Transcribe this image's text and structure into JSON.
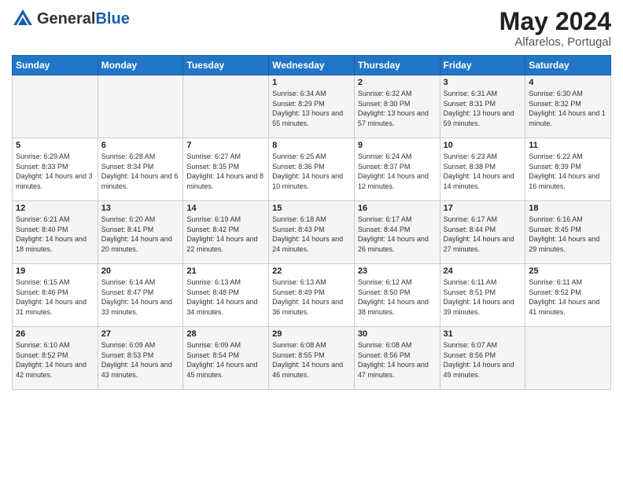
{
  "header": {
    "logo_general": "General",
    "logo_blue": "Blue",
    "month": "May 2024",
    "location": "Alfarelos, Portugal"
  },
  "days_of_week": [
    "Sunday",
    "Monday",
    "Tuesday",
    "Wednesday",
    "Thursday",
    "Friday",
    "Saturday"
  ],
  "weeks": [
    [
      {
        "day": "",
        "sunrise": "",
        "sunset": "",
        "daylight": ""
      },
      {
        "day": "",
        "sunrise": "",
        "sunset": "",
        "daylight": ""
      },
      {
        "day": "",
        "sunrise": "",
        "sunset": "",
        "daylight": ""
      },
      {
        "day": "1",
        "sunrise": "Sunrise: 6:34 AM",
        "sunset": "Sunset: 8:29 PM",
        "daylight": "Daylight: 13 hours and 55 minutes."
      },
      {
        "day": "2",
        "sunrise": "Sunrise: 6:32 AM",
        "sunset": "Sunset: 8:30 PM",
        "daylight": "Daylight: 13 hours and 57 minutes."
      },
      {
        "day": "3",
        "sunrise": "Sunrise: 6:31 AM",
        "sunset": "Sunset: 8:31 PM",
        "daylight": "Daylight: 13 hours and 59 minutes."
      },
      {
        "day": "4",
        "sunrise": "Sunrise: 6:30 AM",
        "sunset": "Sunset: 8:32 PM",
        "daylight": "Daylight: 14 hours and 1 minute."
      }
    ],
    [
      {
        "day": "5",
        "sunrise": "Sunrise: 6:29 AM",
        "sunset": "Sunset: 8:33 PM",
        "daylight": "Daylight: 14 hours and 3 minutes."
      },
      {
        "day": "6",
        "sunrise": "Sunrise: 6:28 AM",
        "sunset": "Sunset: 8:34 PM",
        "daylight": "Daylight: 14 hours and 6 minutes."
      },
      {
        "day": "7",
        "sunrise": "Sunrise: 6:27 AM",
        "sunset": "Sunset: 8:35 PM",
        "daylight": "Daylight: 14 hours and 8 minutes."
      },
      {
        "day": "8",
        "sunrise": "Sunrise: 6:25 AM",
        "sunset": "Sunset: 8:36 PM",
        "daylight": "Daylight: 14 hours and 10 minutes."
      },
      {
        "day": "9",
        "sunrise": "Sunrise: 6:24 AM",
        "sunset": "Sunset: 8:37 PM",
        "daylight": "Daylight: 14 hours and 12 minutes."
      },
      {
        "day": "10",
        "sunrise": "Sunrise: 6:23 AM",
        "sunset": "Sunset: 8:38 PM",
        "daylight": "Daylight: 14 hours and 14 minutes."
      },
      {
        "day": "11",
        "sunrise": "Sunrise: 6:22 AM",
        "sunset": "Sunset: 8:39 PM",
        "daylight": "Daylight: 14 hours and 16 minutes."
      }
    ],
    [
      {
        "day": "12",
        "sunrise": "Sunrise: 6:21 AM",
        "sunset": "Sunset: 8:40 PM",
        "daylight": "Daylight: 14 hours and 18 minutes."
      },
      {
        "day": "13",
        "sunrise": "Sunrise: 6:20 AM",
        "sunset": "Sunset: 8:41 PM",
        "daylight": "Daylight: 14 hours and 20 minutes."
      },
      {
        "day": "14",
        "sunrise": "Sunrise: 6:19 AM",
        "sunset": "Sunset: 8:42 PM",
        "daylight": "Daylight: 14 hours and 22 minutes."
      },
      {
        "day": "15",
        "sunrise": "Sunrise: 6:18 AM",
        "sunset": "Sunset: 8:43 PM",
        "daylight": "Daylight: 14 hours and 24 minutes."
      },
      {
        "day": "16",
        "sunrise": "Sunrise: 6:17 AM",
        "sunset": "Sunset: 8:44 PM",
        "daylight": "Daylight: 14 hours and 26 minutes."
      },
      {
        "day": "17",
        "sunrise": "Sunrise: 6:17 AM",
        "sunset": "Sunset: 8:44 PM",
        "daylight": "Daylight: 14 hours and 27 minutes."
      },
      {
        "day": "18",
        "sunrise": "Sunrise: 6:16 AM",
        "sunset": "Sunset: 8:45 PM",
        "daylight": "Daylight: 14 hours and 29 minutes."
      }
    ],
    [
      {
        "day": "19",
        "sunrise": "Sunrise: 6:15 AM",
        "sunset": "Sunset: 8:46 PM",
        "daylight": "Daylight: 14 hours and 31 minutes."
      },
      {
        "day": "20",
        "sunrise": "Sunrise: 6:14 AM",
        "sunset": "Sunset: 8:47 PM",
        "daylight": "Daylight: 14 hours and 33 minutes."
      },
      {
        "day": "21",
        "sunrise": "Sunrise: 6:13 AM",
        "sunset": "Sunset: 8:48 PM",
        "daylight": "Daylight: 14 hours and 34 minutes."
      },
      {
        "day": "22",
        "sunrise": "Sunrise: 6:13 AM",
        "sunset": "Sunset: 8:49 PM",
        "daylight": "Daylight: 14 hours and 36 minutes."
      },
      {
        "day": "23",
        "sunrise": "Sunrise: 6:12 AM",
        "sunset": "Sunset: 8:50 PM",
        "daylight": "Daylight: 14 hours and 38 minutes."
      },
      {
        "day": "24",
        "sunrise": "Sunrise: 6:11 AM",
        "sunset": "Sunset: 8:51 PM",
        "daylight": "Daylight: 14 hours and 39 minutes."
      },
      {
        "day": "25",
        "sunrise": "Sunrise: 6:11 AM",
        "sunset": "Sunset: 8:52 PM",
        "daylight": "Daylight: 14 hours and 41 minutes."
      }
    ],
    [
      {
        "day": "26",
        "sunrise": "Sunrise: 6:10 AM",
        "sunset": "Sunset: 8:52 PM",
        "daylight": "Daylight: 14 hours and 42 minutes."
      },
      {
        "day": "27",
        "sunrise": "Sunrise: 6:09 AM",
        "sunset": "Sunset: 8:53 PM",
        "daylight": "Daylight: 14 hours and 43 minutes."
      },
      {
        "day": "28",
        "sunrise": "Sunrise: 6:09 AM",
        "sunset": "Sunset: 8:54 PM",
        "daylight": "Daylight: 14 hours and 45 minutes."
      },
      {
        "day": "29",
        "sunrise": "Sunrise: 6:08 AM",
        "sunset": "Sunset: 8:55 PM",
        "daylight": "Daylight: 14 hours and 46 minutes."
      },
      {
        "day": "30",
        "sunrise": "Sunrise: 6:08 AM",
        "sunset": "Sunset: 8:56 PM",
        "daylight": "Daylight: 14 hours and 47 minutes."
      },
      {
        "day": "31",
        "sunrise": "Sunrise: 6:07 AM",
        "sunset": "Sunset: 8:56 PM",
        "daylight": "Daylight: 14 hours and 49 minutes."
      },
      {
        "day": "",
        "sunrise": "",
        "sunset": "",
        "daylight": ""
      }
    ]
  ]
}
